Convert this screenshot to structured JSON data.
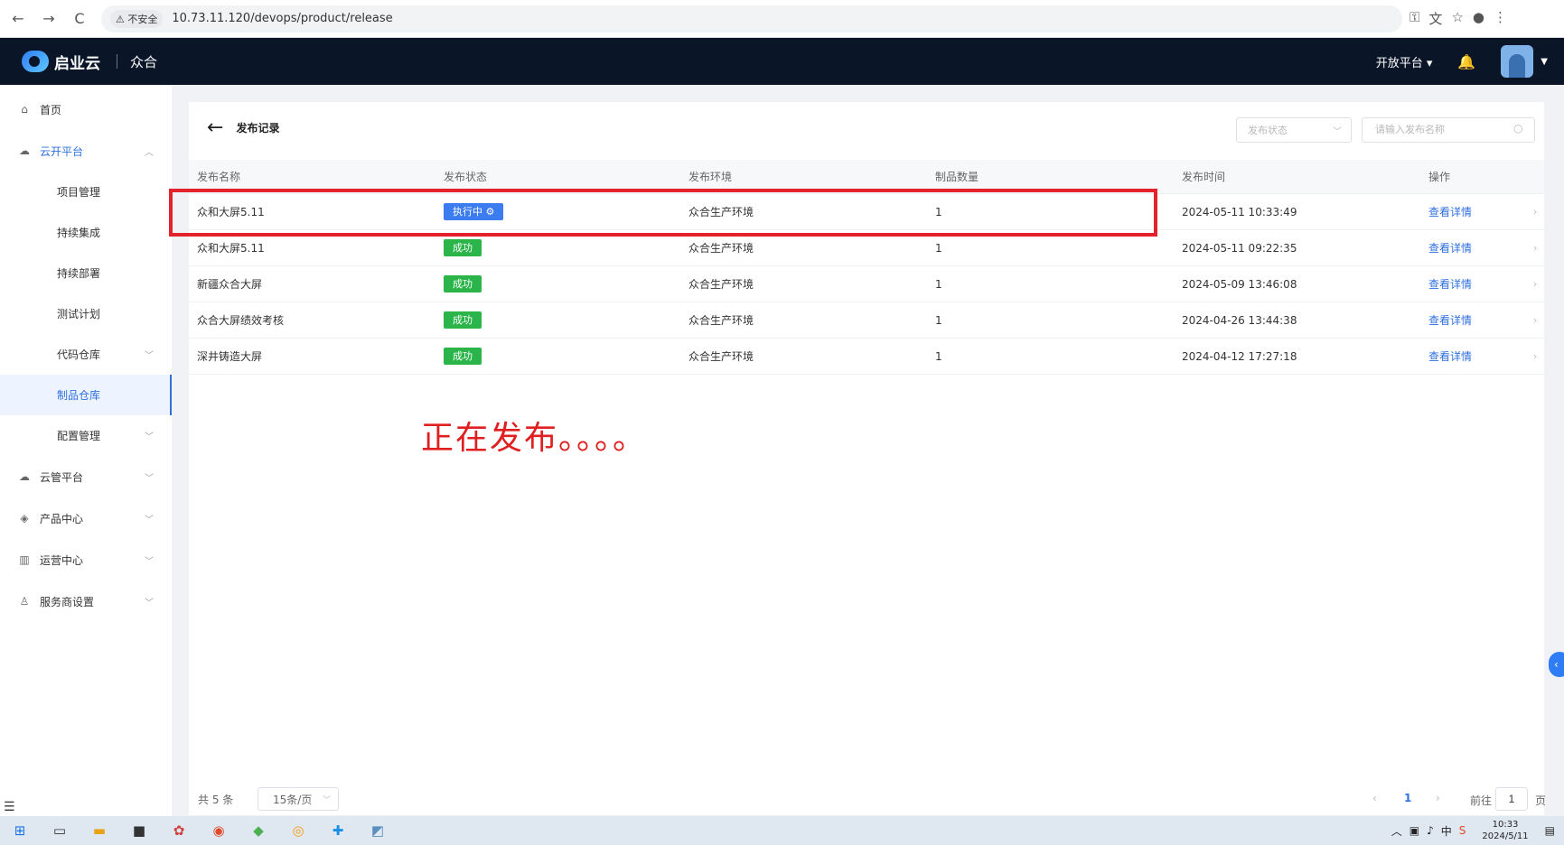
{
  "browser": {
    "back_icon": "←",
    "forward_icon": "→",
    "reload_icon": "C",
    "security_label": "⚠ 不安全",
    "url": "10.73.11.120/devops/product/release"
  },
  "header": {
    "brand_name": "启业云",
    "app_name": "众合",
    "platform_menu": "开放平台 ▾"
  },
  "sidebar": {
    "items": [
      {
        "label": "首页",
        "icon": "home-icon"
      },
      {
        "label": "云开平台",
        "icon": "cloud-icon"
      },
      {
        "label": "项目管理"
      },
      {
        "label": "持续集成"
      },
      {
        "label": "持续部署"
      },
      {
        "label": "测试计划"
      },
      {
        "label": "代码仓库"
      },
      {
        "label": "制品仓库"
      },
      {
        "label": "配置管理"
      },
      {
        "label": "云管平台",
        "icon": "cloud-manage-icon"
      },
      {
        "label": "产品中心",
        "icon": "product-icon"
      },
      {
        "label": "运营中心",
        "icon": "chart-icon"
      },
      {
        "label": "服务商设置",
        "icon": "user-icon"
      }
    ]
  },
  "page": {
    "title": "发布记录",
    "status_filter_placeholder": "发布状态",
    "search_placeholder": "请输入发布名称"
  },
  "table": {
    "columns": [
      "发布名称",
      "发布状态",
      "发布环境",
      "制品数量",
      "发布时间",
      "操作"
    ],
    "rows": [
      {
        "name": "众和大屏5.11",
        "status": "执行中 ⚙",
        "env": "众合生产环境",
        "count": "1",
        "time": "2024-05-11 10:33:49",
        "action": "查看详情"
      },
      {
        "name": "众和大屏5.11",
        "status": "成功",
        "env": "众合生产环境",
        "count": "1",
        "time": "2024-05-11 09:22:35",
        "action": "查看详情"
      },
      {
        "name": "新疆众合大屏",
        "status": "成功",
        "env": "众合生产环境",
        "count": "1",
        "time": "2024-05-09 13:46:08",
        "action": "查看详情"
      },
      {
        "name": "众合大屏绩效考核",
        "status": "成功",
        "env": "众合生产环境",
        "count": "1",
        "time": "2024-04-26 13:44:38",
        "action": "查看详情"
      },
      {
        "name": "深井铸造大屏",
        "status": "成功",
        "env": "众合生产环境",
        "count": "1",
        "time": "2024-04-12 17:27:18",
        "action": "查看详情"
      }
    ]
  },
  "annotation": "正在发布。。。。",
  "pagination": {
    "total": "共 5 条",
    "page_size": "15条/页",
    "current_page": "1",
    "goto_label": "前往",
    "goto_value": "1",
    "goto_suffix": "页"
  },
  "taskbar": {
    "time": "10:33",
    "date": "2024/5/11"
  },
  "colors": {
    "accent": "#2f6fe0",
    "running": "#3b7cf0",
    "success": "#2ab44a",
    "highlight": "#e3222b",
    "header_bg": "#0a1628"
  }
}
